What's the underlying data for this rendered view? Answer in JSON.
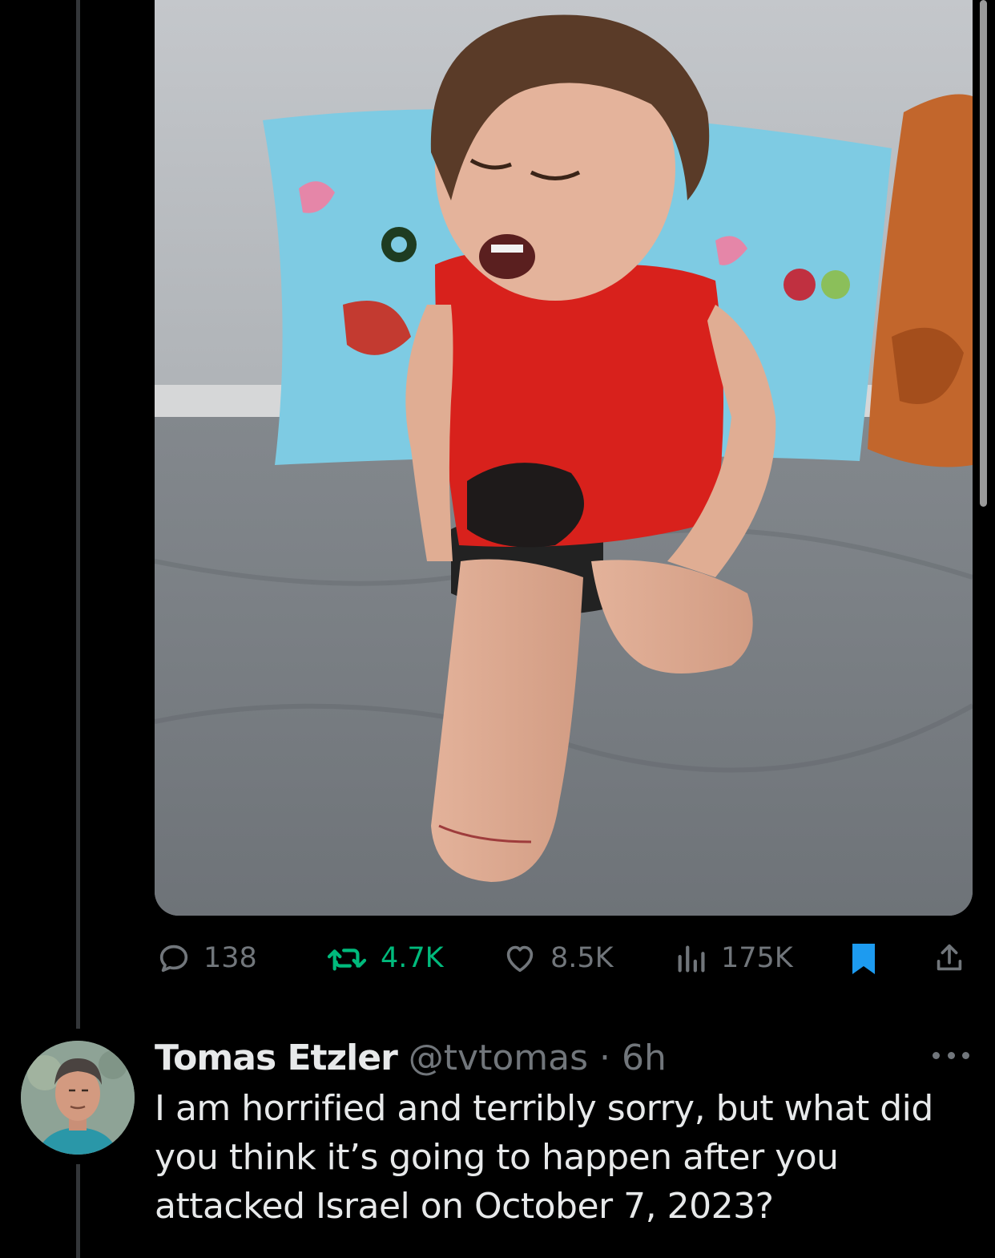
{
  "tweet": {
    "media_alt": "photo",
    "actions": {
      "replies": "138",
      "retweets": "4.7K",
      "likes": "8.5K",
      "views": "175K"
    },
    "colors": {
      "retweet_active": "#00ba7c",
      "bookmark_active": "#1d9bf0",
      "muted": "#71767b"
    }
  },
  "reply": {
    "author_name": "Tomas Etzler",
    "author_handle": "@tvtomas",
    "separator": "·",
    "time": "6h",
    "text": "I am horrified and terribly sorry, but what did you think it’s going to happen after you attacked Israel on October 7, 2023?"
  },
  "icons": {
    "reply": "reply-bubble-icon",
    "retweet": "retweet-icon",
    "like": "heart-icon",
    "views": "views-bar-icon",
    "bookmark": "bookmark-icon",
    "share": "share-icon",
    "more": "more-horizontal-icon"
  }
}
